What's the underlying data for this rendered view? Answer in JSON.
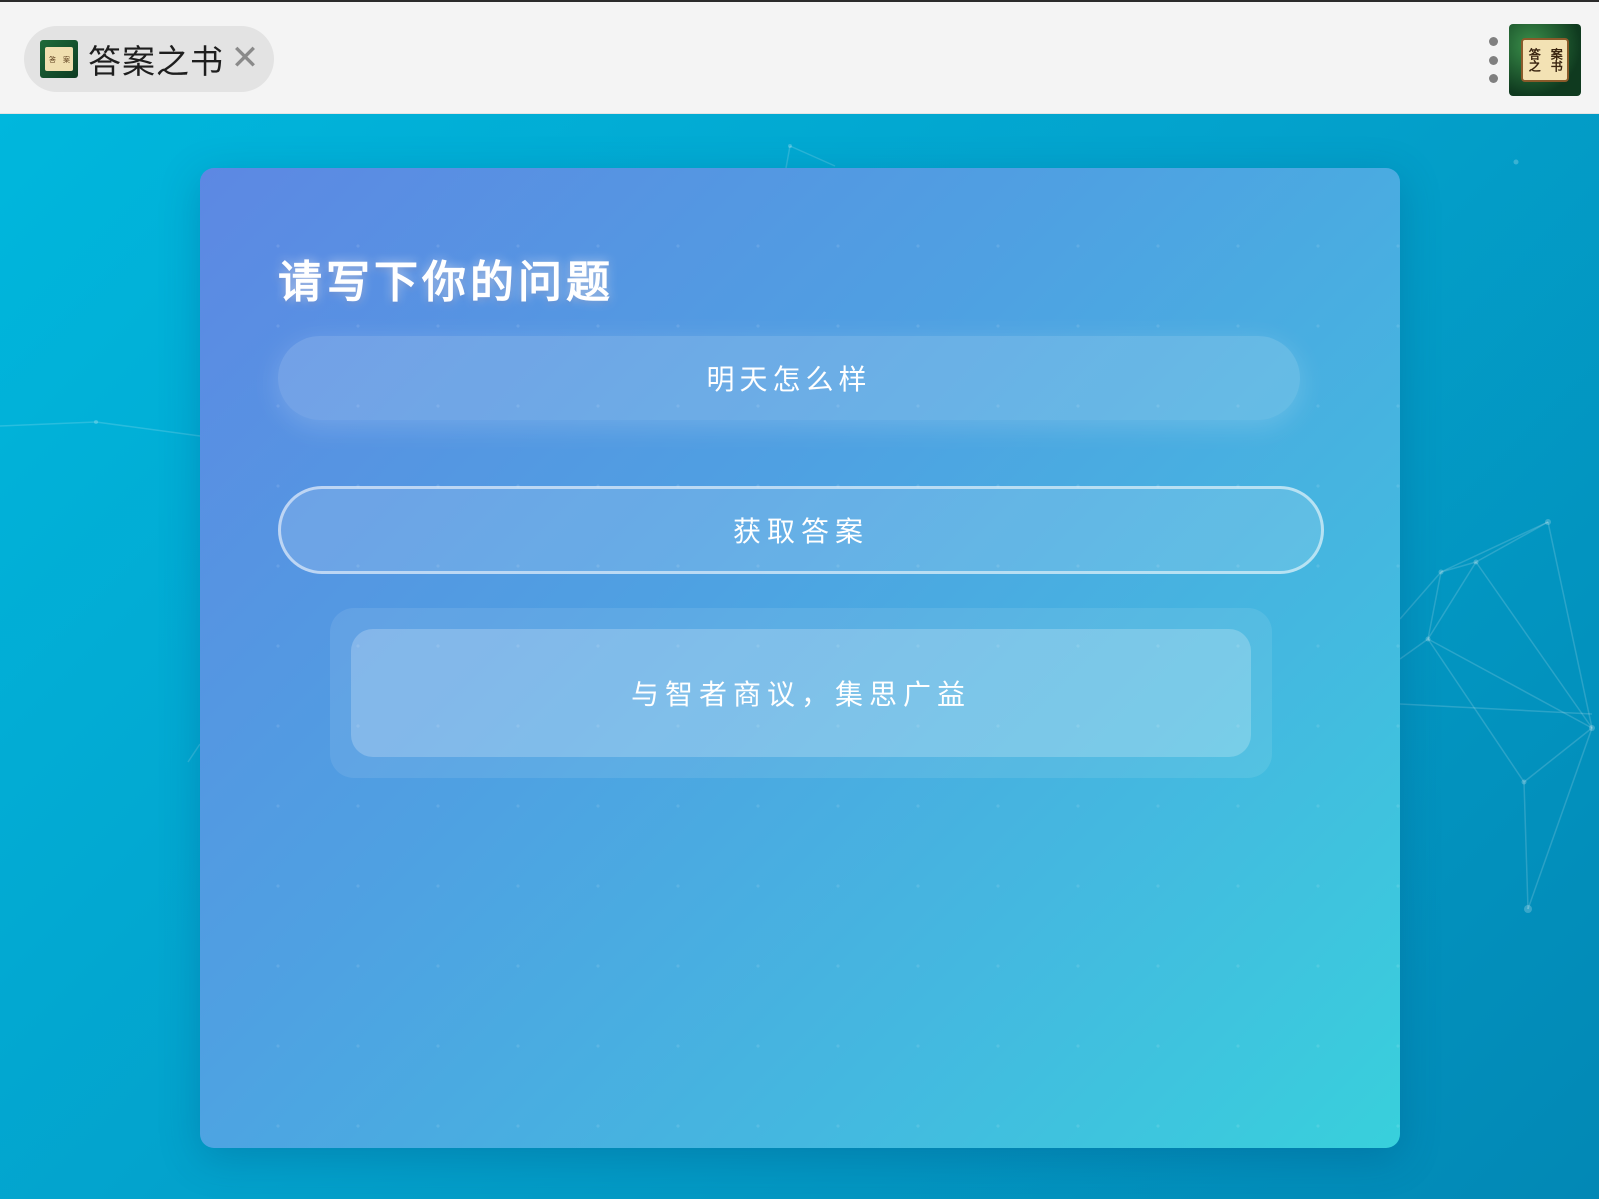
{
  "browser": {
    "tab_title": "答案之书",
    "tab_close_glyph": "✕",
    "tab_icon": "book-of-answers-logo",
    "menu_icon": "more-vertical-icon",
    "app_logo_icon": "book-of-answers-logo",
    "logo_text": [
      "答",
      "案",
      "之",
      "书"
    ]
  },
  "page": {
    "heading": "请写下你的问题",
    "question_value": "明天怎么样",
    "get_answer_label": "获取答案",
    "answer_text": "与智者商议，集思广益"
  },
  "colors": {
    "background": "#03a3cd",
    "card_start": "#5d88e3",
    "card_end": "#38d0dc",
    "text": "#ffffff"
  }
}
